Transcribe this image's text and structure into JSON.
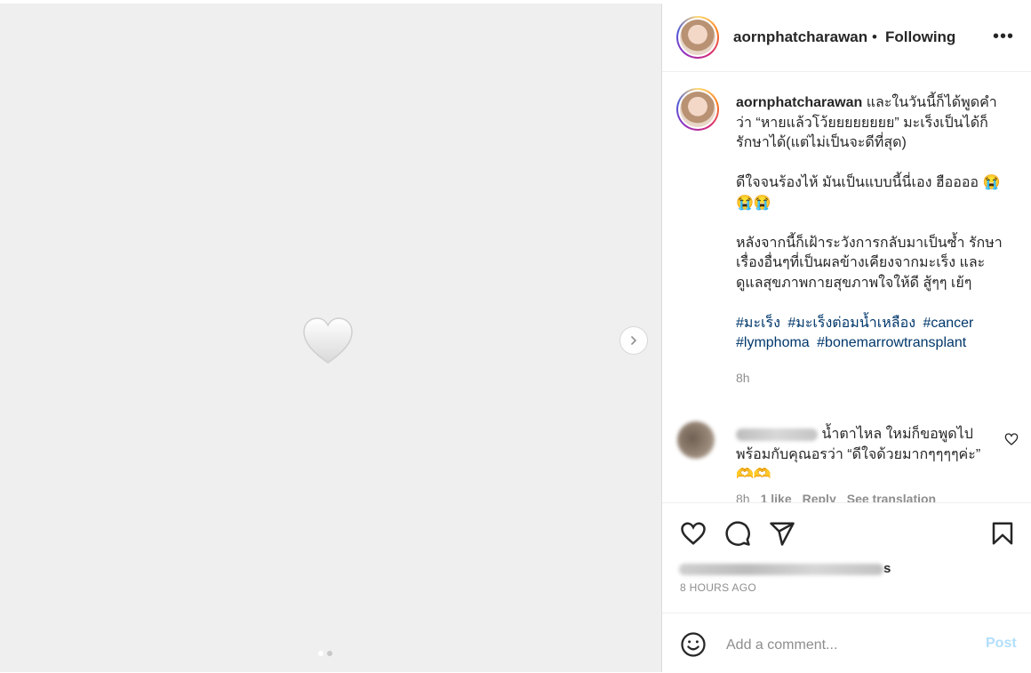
{
  "post": {
    "username": "aornphatcharawan",
    "separator": "•",
    "follow_status": "Following",
    "more_glyph": "•••"
  },
  "caption": {
    "username": "aornphatcharawan",
    "line1": "และในวันนี้ก็ได้พูดคำว่า “หายแล้วโว้ยยยยยยยย” มะเร็งเป็นได้ก็รักษาได้(แต่ไม่เป็นจะดีที่สุด)",
    "line2": "ดีใจจนร้องไห้ มันเป็นแบบนี้นี่เอง ฮืออออ 😭😭😭",
    "line3": "หลังจากนี้ก็เฝ้าระวังการกลับมาเป็นซ้ำ รักษาเรื่องอื่นๆที่เป็นผลข้างเคียงจากมะเร็ง และดูแลสุขภาพกายสุขภาพใจให้ดี สู้ๆๆ เย้ๆ",
    "hashtags": [
      "#มะเร็ง",
      "#มะเร็งต่อมน้ำเหลือง",
      "#cancer",
      "#lymphoma",
      "#bonemarrowtransplant"
    ],
    "time": "8h"
  },
  "comment": {
    "text": "น้ำตาไหล ใหม่ก็ขอพูดไปพร้อมกับคุณอรว่า “ดีใจด้วยมากๆๆๆๆค่ะ” 🫶🫶",
    "time": "8h",
    "likes": "1 like",
    "reply": "Reply",
    "translate": "See translation"
  },
  "actions": {
    "liked_suffix": "s",
    "timestamp": "8 HOURS AGO"
  },
  "add_comment": {
    "placeholder": "Add a comment...",
    "post_label": "Post"
  },
  "media": {
    "emoji": "🤍",
    "slides": 2,
    "current_slide": 1
  },
  "colors": {
    "hashtag": "#00376b",
    "muted": "#8e8e8e",
    "post_disabled": "#b2dffc"
  }
}
